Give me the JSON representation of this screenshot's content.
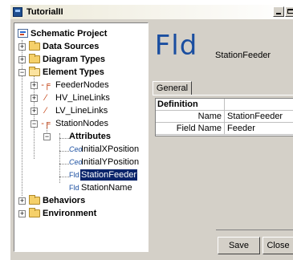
{
  "window": {
    "title": "TutorialII"
  },
  "tree": {
    "root": "Schematic Project",
    "data_sources": "Data Sources",
    "diagram_types": "Diagram Types",
    "element_types": "Element Types",
    "feeder_nodes": "FeederNodes",
    "hv_linelinks": "HV_LineLinks",
    "lv_linelinks": "LV_LineLinks",
    "station_nodes": "StationNodes",
    "attributes": "Attributes",
    "attr_items": [
      {
        "icon": "Ceo",
        "label": "InitialXPosition"
      },
      {
        "icon": "Ceo",
        "label": "InitialYPosition"
      },
      {
        "icon": "Fld",
        "label": "StationFeeder",
        "selected": true
      },
      {
        "icon": "Fld",
        "label": "StationName"
      }
    ],
    "behaviors": "Behaviors",
    "environment": "Environment"
  },
  "detail": {
    "icon_text": "Fld",
    "name_text": "StationFeeder",
    "tab_general": "General",
    "properties": {
      "header": "Definition",
      "rows": [
        {
          "key": "Name",
          "value": "StationFeeder"
        },
        {
          "key": "Field Name",
          "value": "Feeder"
        }
      ]
    }
  },
  "buttons": {
    "save": "Save",
    "close": "Close"
  }
}
